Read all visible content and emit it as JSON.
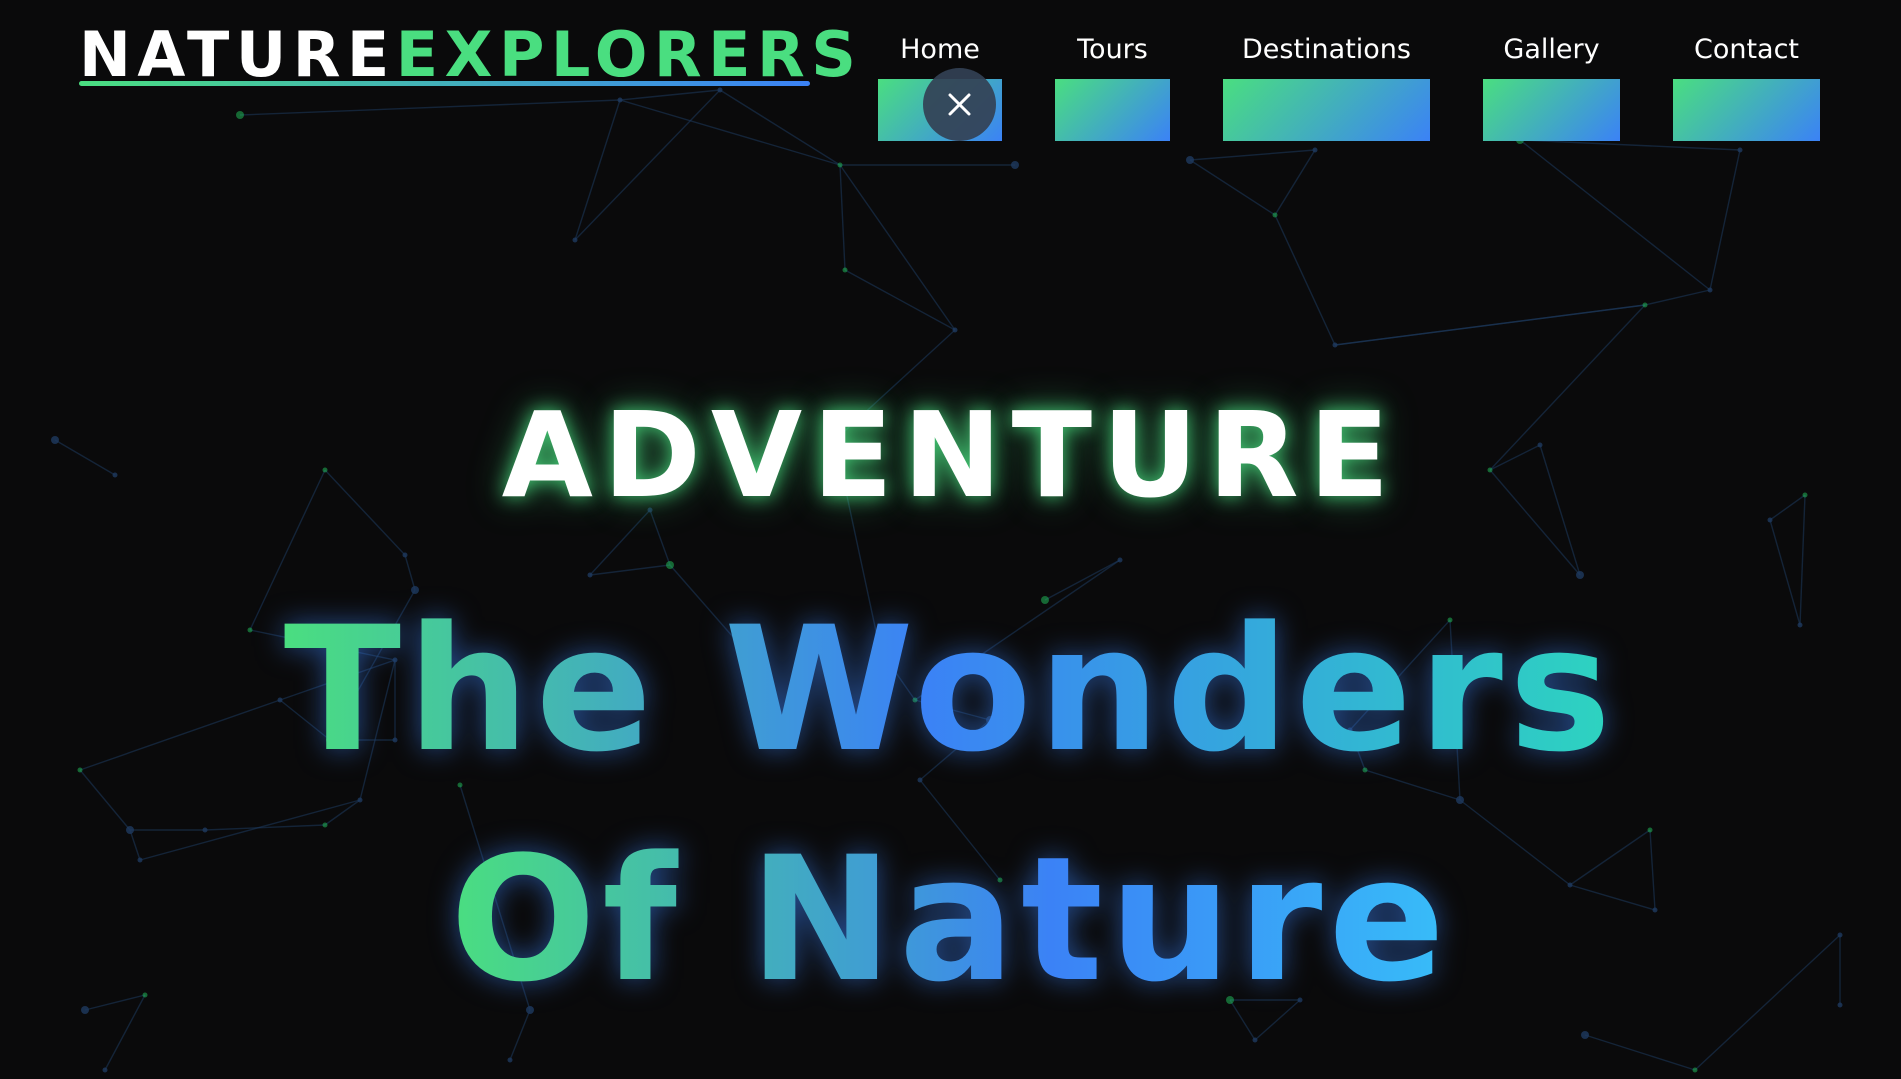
{
  "brand": {
    "part1": "NATURE",
    "part2": "EXPLORERS"
  },
  "nav": {
    "items": [
      {
        "label": "Home"
      },
      {
        "label": "Tours"
      },
      {
        "label": "Destinations"
      },
      {
        "label": "Gallery"
      },
      {
        "label": "Contact"
      }
    ],
    "close_icon": "close-icon"
  },
  "hero": {
    "kicker": "ADVENTURE",
    "title_line1": "The Wonders",
    "title_line2": "Of Nature"
  },
  "colors": {
    "background": "#0a0a0b",
    "accent_green": "#4ade80",
    "accent_blue": "#3b82f6",
    "network_line": "#1e3a5f",
    "network_node": "#22c55e"
  }
}
